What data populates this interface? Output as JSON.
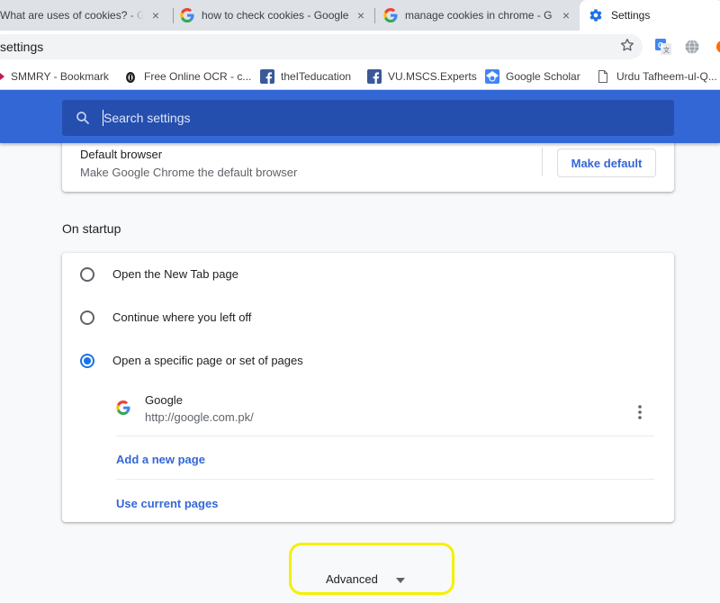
{
  "tabs": [
    {
      "title": "What are uses of cookies? - Go",
      "icon": "google-g-icon",
      "active": false
    },
    {
      "title": "how to check cookies - Google",
      "icon": "google-g-icon",
      "active": false
    },
    {
      "title": "manage cookies in chrome - G",
      "icon": "google-g-icon",
      "active": false
    },
    {
      "title": "Settings",
      "icon": "gear-icon",
      "active": true
    }
  ],
  "omnibox": {
    "url": "settings"
  },
  "bookmarks": [
    {
      "label": "SMMRY - Bookmark",
      "icon": "smmry-icon"
    },
    {
      "label": "Free Online OCR - c...",
      "icon": "ocr-icon"
    },
    {
      "label": "theITeducation",
      "icon": "facebook-icon"
    },
    {
      "label": "VU.MSCS.Experts",
      "icon": "facebook-icon"
    },
    {
      "label": "Google Scholar",
      "icon": "scholar-icon"
    },
    {
      "label": "Urdu Tafheem-ul-Q...",
      "icon": "page-icon"
    }
  ],
  "search": {
    "placeholder": "Search settings"
  },
  "default_browser": {
    "title": "Default browser",
    "subtitle": "Make Google Chrome the default browser",
    "button": "Make default"
  },
  "on_startup": {
    "title": "On startup",
    "options": [
      {
        "label": "Open the New Tab page",
        "selected": false
      },
      {
        "label": "Continue where you left off",
        "selected": false
      },
      {
        "label": "Open a specific page or set of pages",
        "selected": true
      }
    ],
    "pages": [
      {
        "name": "Google",
        "url": "http://google.com.pk/"
      }
    ],
    "add_page": "Add a new page",
    "use_current": "Use current pages"
  },
  "advanced": {
    "label": "Advanced"
  },
  "colors": {
    "header_blue": "#3367d6",
    "link_blue": "#3367d6",
    "radio_blue": "#1a73e8",
    "highlight_yellow": "#f5f000"
  }
}
